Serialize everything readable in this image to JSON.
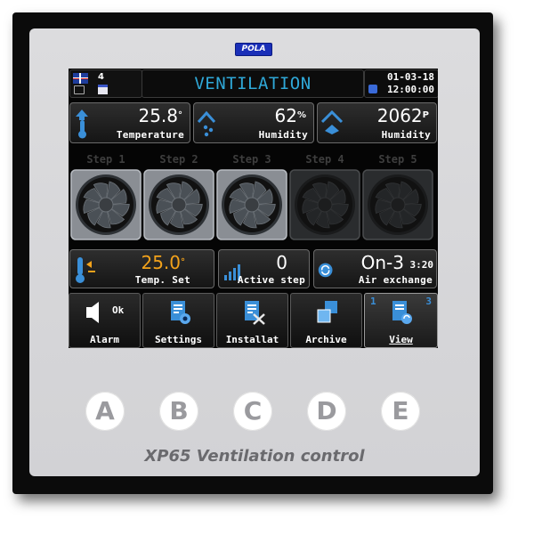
{
  "brand": "POLA",
  "header": {
    "week_number": "4",
    "title": "VENTILATION",
    "date": "01-03-18",
    "time": "12:00:00"
  },
  "sensors": [
    {
      "value": "25.8",
      "unit": "°",
      "label": "Temperature",
      "icon": "thermometer-up-icon"
    },
    {
      "value": "62",
      "unit": "%",
      "label": "Humidity",
      "icon": "humidity-drops-icon"
    },
    {
      "value": "2062",
      "unit": "P",
      "label": "Humidity",
      "icon": "pressure-house-icon"
    }
  ],
  "steps": [
    {
      "label": "Step 1",
      "state": "on"
    },
    {
      "label": "Step 2",
      "state": "on"
    },
    {
      "label": "Step 3",
      "state": "on"
    },
    {
      "label": "Step 4",
      "state": "off"
    },
    {
      "label": "Step 5",
      "state": "off"
    }
  ],
  "status": {
    "temp_set": {
      "value": "25.0",
      "unit": "°",
      "label": "Temp. Set",
      "color": "#f2a21b"
    },
    "active_step": {
      "value": "0",
      "label": "Active step"
    },
    "air_exchange": {
      "value": "On-3",
      "extra": "3:20",
      "label": "Air exchange"
    }
  },
  "nav": [
    {
      "label": "Alarm",
      "badge": "Ok",
      "icon": "speaker-icon"
    },
    {
      "label": "Settings",
      "icon": "settings-document-icon"
    },
    {
      "label": "Installat",
      "icon": "installation-document-icon"
    },
    {
      "label": "Archive",
      "icon": "archive-icon"
    },
    {
      "label": "View",
      "page_left": "1",
      "page_right": "3",
      "icon": "view-document-icon",
      "active": true
    }
  ],
  "keys": [
    "A",
    "B",
    "C",
    "D",
    "E"
  ],
  "caption": "XP65 Ventilation control",
  "colors": {
    "accent": "#2fa8d8",
    "setpoint": "#f2a21b",
    "icon_blue": "#3a8fd8"
  }
}
